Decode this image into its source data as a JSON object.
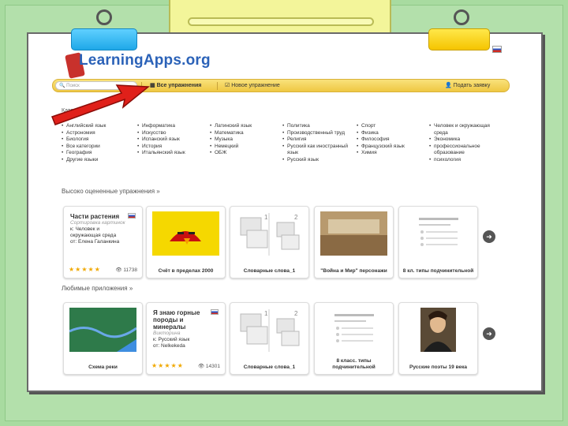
{
  "logo": {
    "text": "LearningApps.org"
  },
  "navbar": {
    "search_placeholder": "Поиск",
    "all_exercises": "Все упражнения",
    "new_exercise": "Новое упражнение",
    "submit_request": "Подать заявку"
  },
  "categories": {
    "title": "Категории",
    "columns": [
      [
        "Английский язык",
        "Астрономия",
        "Биология",
        "Все категории",
        "География",
        "Другие языки"
      ],
      [
        "Информатика",
        "Искусство",
        "Испанский язык",
        "История",
        "Итальянский язык"
      ],
      [
        "Латинский язык",
        "Математика",
        "Музыка",
        "Немецкий",
        "ОБЖ"
      ],
      [
        "Политика",
        "Производственный труд",
        "Религия",
        "Русский как иностранный язык",
        "Русский язык"
      ],
      [
        "Спорт",
        "Физика",
        "Философия",
        "Французский язык",
        "Химия"
      ],
      [
        "Человек и окружающая среда",
        "Экономика",
        "профессиональное образование",
        "психология"
      ]
    ]
  },
  "sections": {
    "top_rated": "Высоко оцененные упражнения »",
    "favorites": "Любимые приложения »"
  },
  "top_cards": [
    {
      "title": "Части растения",
      "sub": "Сортировка картинок",
      "line1": "к: Человек и окружающая среда",
      "line2": "от: Елена Галанкина",
      "stars": "★★★★★",
      "views": "👁 11738"
    },
    {
      "caption": "Счёт в пределах 2000"
    },
    {
      "caption": "Словарные слова_1"
    },
    {
      "caption": "\"Война и Мир\" персонажи"
    },
    {
      "caption": "8 кл. типы подчинительной"
    }
  ],
  "fav_cards": [
    {
      "caption": "Схема реки"
    },
    {
      "title": "Я знаю горные породы и минералы",
      "sub": "Викторина",
      "line1": "к: Русский язык",
      "line2": "от: Nelkekeda",
      "stars": "★★★★★",
      "views": "👁 14301"
    },
    {
      "caption": "Словарные слова_1"
    },
    {
      "caption": "8 класс. типы подчинительной"
    },
    {
      "caption": "Русские поэты 19 века"
    }
  ],
  "colors": {
    "background": "#a8dba0",
    "accent_blue": "#2b62b8",
    "nav_yellow": "#efc743",
    "arrow_red": "#e0201a"
  }
}
